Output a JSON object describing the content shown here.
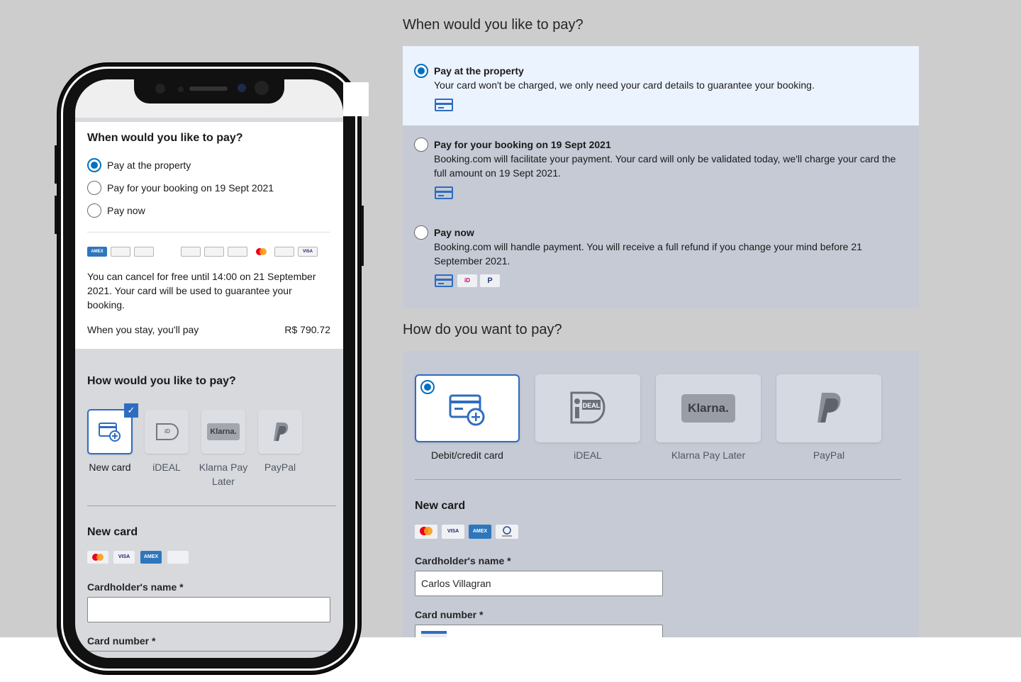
{
  "right": {
    "when_title": "When would you like to pay?",
    "options": [
      {
        "title": "Pay at the property",
        "desc": "Your card won't be charged, we only need your card details to guarantee your booking.",
        "selected": true
      },
      {
        "title": "Pay for your booking on 19 Sept 2021",
        "desc": "Booking.com will facilitate your payment. Your card will only be validated today, we'll charge your card the full amount on 19 Sept 2021.",
        "selected": false
      },
      {
        "title": "Pay now",
        "desc": "Booking.com will handle payment. You will receive a full refund if you change your mind before 21 September 2021.",
        "selected": false
      }
    ],
    "how_title": "How do you want to pay?",
    "methods": [
      {
        "label": "Debit/credit card",
        "icon": "card-plus-icon",
        "selected": true
      },
      {
        "label": "iDEAL",
        "icon": "ideal-icon",
        "selected": false
      },
      {
        "label": "Klarna Pay Later",
        "icon": "klarna-icon",
        "logo_text": "Klarna.",
        "selected": false
      },
      {
        "label": "PayPal",
        "icon": "paypal-icon",
        "selected": false
      }
    ],
    "new_card_title": "New card",
    "cardholder_label": "Cardholder's name *",
    "cardholder_value": "Carlos Villagran",
    "card_number_label": "Card number *"
  },
  "mobile": {
    "when_title": "When would you like to pay?",
    "options": [
      {
        "label": "Pay at the property",
        "selected": true
      },
      {
        "label": "Pay for your booking on 19 Sept 2021",
        "selected": false
      },
      {
        "label": "Pay now",
        "selected": false
      }
    ],
    "cancel_text": "You can cancel for free until 14:00 on 21 September 2021. Your card will be used to guarantee your booking.",
    "stay_label": "When you stay, you'll pay",
    "stay_amount": "R$ 790.72",
    "how_title": "How would you like to pay?",
    "methods": [
      {
        "label": "New card",
        "selected": true
      },
      {
        "label": "iDEAL",
        "selected": false
      },
      {
        "label": "Klarna Pay Later",
        "logo_text": "Klarna.",
        "selected": false
      },
      {
        "label": "PayPal",
        "selected": false
      }
    ],
    "new_card_title": "New card",
    "cardholder_label": "Cardholder's name *",
    "cardholder_value": "",
    "card_number_label": "Card number *"
  },
  "brands": {
    "amex": "AMEX",
    "visa": "VISA",
    "ideal_mark": "iD"
  },
  "colors": {
    "accent": "#0071c2",
    "card_icon": "#2e6cc0",
    "selected_bg": "#ebf3ff",
    "panel_bg": "#c5cad5",
    "page_bg": "#cdcdcd",
    "mastercard_red": "#eb001b",
    "mastercard_orange": "#f79e1b",
    "paypal_dark": "#253b80",
    "ideal_pink": "#cc0066"
  }
}
